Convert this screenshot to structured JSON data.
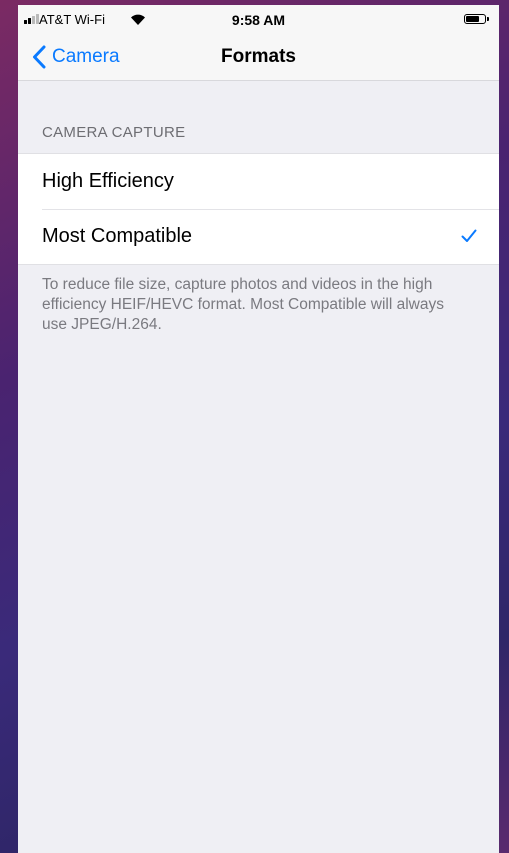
{
  "status_bar": {
    "carrier": "AT&T Wi-Fi",
    "time": "9:58 AM",
    "battery_level": 0.7,
    "signal_bars": 2,
    "icons": [
      "signal-icon",
      "wifi-icon",
      "battery-icon"
    ]
  },
  "nav": {
    "back_label": "Camera",
    "title": "Formats",
    "accent_color": "#0a7aff"
  },
  "section": {
    "header": "CAMERA CAPTURE",
    "options": [
      {
        "label": "High Efficiency",
        "selected": false
      },
      {
        "label": "Most Compatible",
        "selected": true
      }
    ],
    "footer": "To reduce file size, capture photos and videos in the high efficiency HEIF/HEVC format. Most Compatible will always use JPEG/H.264."
  }
}
